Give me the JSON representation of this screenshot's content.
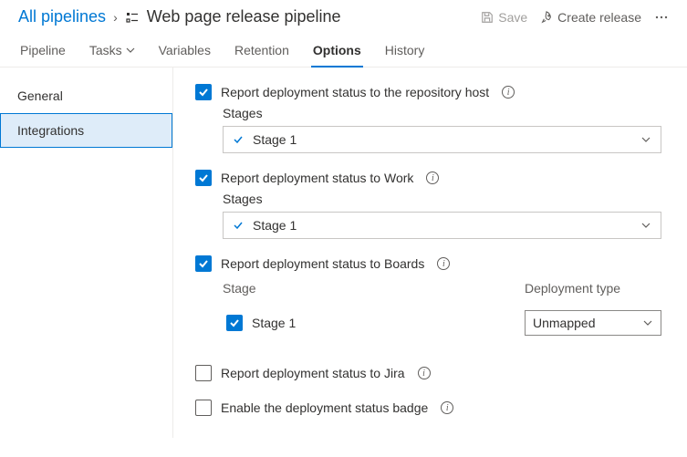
{
  "breadcrumb": {
    "root": "All pipelines",
    "title": "Web page release pipeline"
  },
  "actions": {
    "save": "Save",
    "create_release": "Create release"
  },
  "tabs": {
    "pipeline": "Pipeline",
    "tasks": "Tasks",
    "variables": "Variables",
    "retention": "Retention",
    "options": "Options",
    "history": "History"
  },
  "sidebar": {
    "general": "General",
    "integrations": "Integrations"
  },
  "options": {
    "repo_host": {
      "label": "Report deployment status to the repository host",
      "stages_label": "Stages",
      "selected_stage": "Stage 1"
    },
    "work": {
      "label": "Report deployment status to Work",
      "stages_label": "Stages",
      "selected_stage": "Stage 1"
    },
    "boards": {
      "label": "Report deployment status to Boards",
      "col_stage": "Stage",
      "col_type": "Deployment type",
      "row_stage": "Stage 1",
      "row_type": "Unmapped"
    },
    "jira": {
      "label": "Report deployment status to Jira"
    },
    "badge": {
      "label": "Enable the deployment status badge"
    }
  }
}
